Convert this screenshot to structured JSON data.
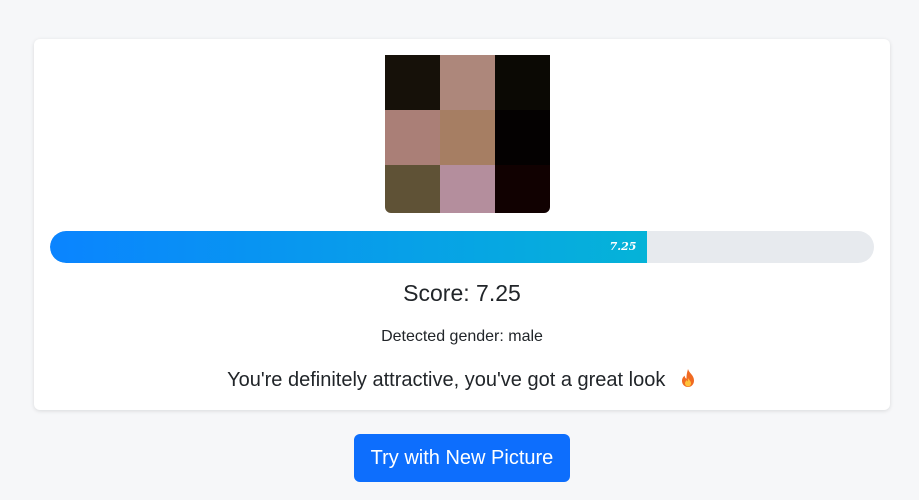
{
  "photo": {
    "icon": "pixelated-face-photo",
    "pixel_colors": [
      "#161109",
      "#ad877b",
      "#0b0904",
      "#aa7f77",
      "#a67e63",
      "#040101",
      "#5f5236",
      "#b48e9d",
      "#110101"
    ]
  },
  "progress": {
    "value": 7.25,
    "max": 10,
    "label": "7.25",
    "fill_start": "#0a84ff",
    "fill_end": "#05b3d8"
  },
  "result": {
    "score_text": "Score: 7.25",
    "gender_text": "Detected gender: male",
    "verdict_text": "You're definitely attractive, you've got a great look",
    "verdict_icon": "fire-icon"
  },
  "actions": {
    "try_again_label": "Try with New Picture",
    "accent": "#0d6efd"
  }
}
